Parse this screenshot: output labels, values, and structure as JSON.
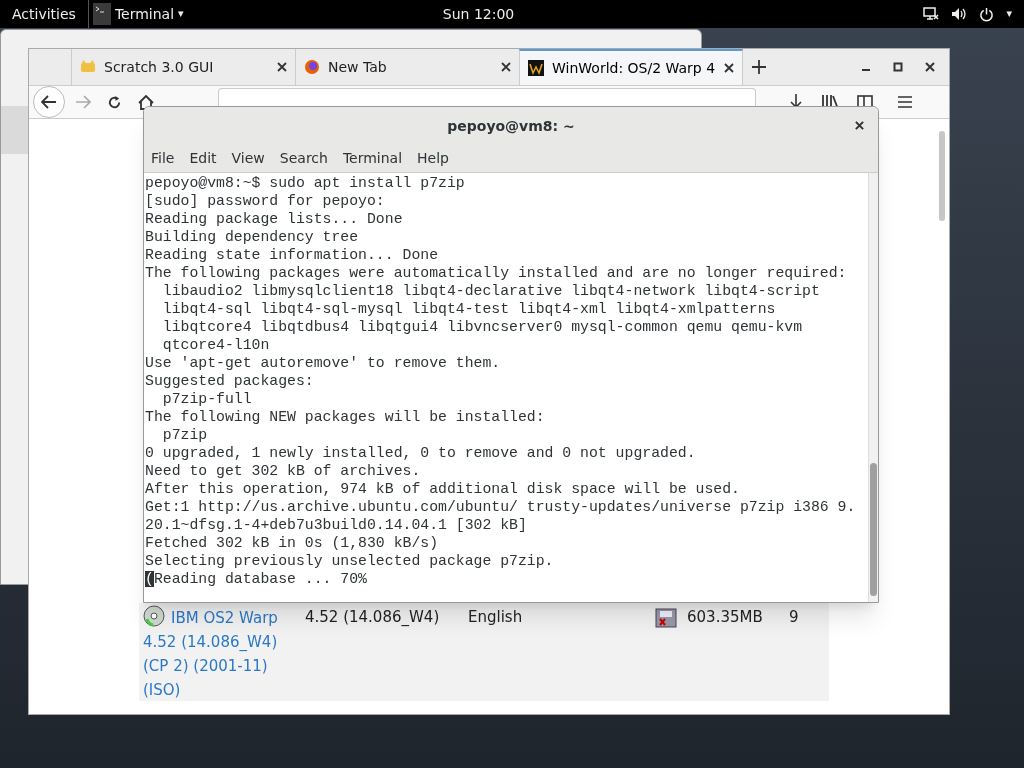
{
  "top_bar": {
    "activities": "Activities",
    "app_menu": "Terminal",
    "app_menu_arrow": "▾",
    "clock": "Sun 12:00",
    "system_arrow": "▾"
  },
  "browser": {
    "tabs": [
      {
        "label": "Scratch 3.0 GUI",
        "selected": false
      },
      {
        "label": "New Tab",
        "selected": false
      },
      {
        "label": "WinWorld: OS/2 Warp 4",
        "selected": true
      }
    ],
    "download_row": {
      "title": "IBM OS2 Warp 4.52 (14.086_W4) (CP 2) (2001-11) (ISO)",
      "version": "4.52 (14.086_W4)",
      "language": "English",
      "size": "603.35MB",
      "column_6": "9"
    }
  },
  "terminal": {
    "title": "pepoyo@vm8: ~",
    "menu": [
      "File",
      "Edit",
      "View",
      "Search",
      "Terminal",
      "Help"
    ],
    "lines": [
      {
        "text": "pepoyo@vm8:~$ sudo apt install p7zip",
        "cursor": false
      },
      {
        "text": "[sudo] password for pepoyo:",
        "cursor": false
      },
      {
        "text": "Reading package lists... Done",
        "cursor": false
      },
      {
        "text": "Building dependency tree",
        "cursor": false
      },
      {
        "text": "Reading state information... Done",
        "cursor": false
      },
      {
        "text": "The following packages were automatically installed and are no longer required:",
        "cursor": false
      },
      {
        "text": "  libaudio2 libmysqlclient18 libqt4-declarative libqt4-network libqt4-script",
        "cursor": false
      },
      {
        "text": "  libqt4-sql libqt4-sql-mysql libqt4-test libqt4-xml libqt4-xmlpatterns",
        "cursor": false
      },
      {
        "text": "  libqtcore4 libqtdbus4 libqtgui4 libvncserver0 mysql-common qemu qemu-kvm",
        "cursor": false
      },
      {
        "text": "  qtcore4-l10n",
        "cursor": false
      },
      {
        "text": "Use 'apt-get autoremove' to remove them.",
        "cursor": false
      },
      {
        "text": "Suggested packages:",
        "cursor": false
      },
      {
        "text": "  p7zip-full",
        "cursor": false
      },
      {
        "text": "The following NEW packages will be installed:",
        "cursor": false
      },
      {
        "text": "  p7zip",
        "cursor": false
      },
      {
        "text": "0 upgraded, 1 newly installed, 0 to remove and 0 not upgraded.",
        "cursor": false
      },
      {
        "text": "Need to get 302 kB of archives.",
        "cursor": false
      },
      {
        "text": "After this operation, 974 kB of additional disk space will be used.",
        "cursor": false
      },
      {
        "text": "Get:1 http://us.archive.ubuntu.com/ubuntu/ trusty-updates/universe p7zip i386 9.",
        "cursor": false
      },
      {
        "text": "20.1~dfsg.1-4+deb7u3build0.14.04.1 [302 kB]",
        "cursor": false
      },
      {
        "text": "Fetched 302 kB in 0s (1,830 kB/s)",
        "cursor": false
      },
      {
        "text": "Selecting previously unselected package p7zip.",
        "cursor": false
      },
      {
        "text": "(Reading database ... 70%",
        "cursor": true
      }
    ]
  }
}
